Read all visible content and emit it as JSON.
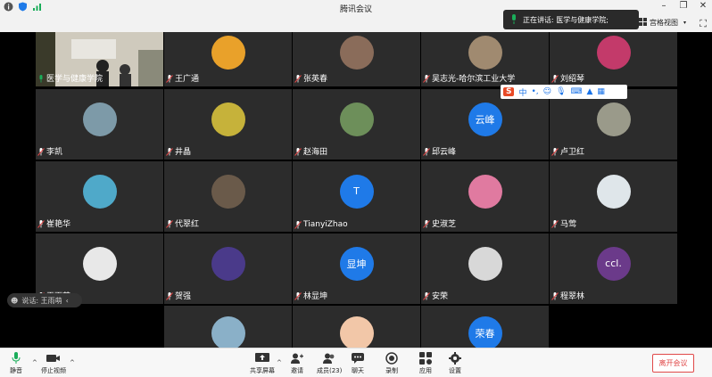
{
  "window": {
    "title": "腾讯会议"
  },
  "speaking_banner": {
    "label": "正在讲话: 医学与健康学院;"
  },
  "view": {
    "grid_label": "宫格视图"
  },
  "participants": [
    {
      "name": "医学与健康学院",
      "type": "video"
    },
    {
      "name": "王广通",
      "avatar": "garfield",
      "color": "#e9a12a"
    },
    {
      "name": "张英春",
      "avatar": "photo",
      "color": "#8a6c5a"
    },
    {
      "name": "吴志光-哈尔滨工业大学",
      "avatar": "photo",
      "color": "#a08a70"
    },
    {
      "name": "刘绍琴",
      "avatar": "flower",
      "color": "#c33a6a"
    },
    {
      "name": "李凯",
      "avatar": "photo",
      "color": "#7d9aa8"
    },
    {
      "name": "井晶",
      "avatar": "fruit",
      "color": "#c6b23a"
    },
    {
      "name": "赵海田",
      "avatar": "photo",
      "color": "#6d8f5a"
    },
    {
      "name": "邱云峰",
      "avatar": "text",
      "text": "云峰",
      "color": "#1f7ae8"
    },
    {
      "name": "卢卫红",
      "avatar": "photo",
      "color": "#9a9a8a"
    },
    {
      "name": "崔艳华",
      "avatar": "beach",
      "color": "#4fa9c9"
    },
    {
      "name": "代翠红",
      "avatar": "cat",
      "color": "#6a5a4a"
    },
    {
      "name": "TianyiZhao",
      "avatar": "text",
      "text": "T",
      "color": "#1f7ae8"
    },
    {
      "name": "史淑芝",
      "avatar": "flower",
      "color": "#e07aa0"
    },
    {
      "name": "马莺",
      "avatar": "baby",
      "color": "#dfe6ea"
    },
    {
      "name": "王雨萌",
      "avatar": "person",
      "color": "#e8e8e8"
    },
    {
      "name": "贺强",
      "avatar": "spiderman",
      "color": "#4a3a8a"
    },
    {
      "name": "林显坤",
      "avatar": "text",
      "text": "显坤",
      "color": "#1f7ae8"
    },
    {
      "name": "安荣",
      "avatar": "sketch",
      "color": "#d8d8d8"
    },
    {
      "name": "程翠林",
      "avatar": "text",
      "text": "ccl.",
      "color": "#6b3a8a"
    },
    {
      "name": "",
      "avatar": "sea",
      "color": "#8ab0c8"
    },
    {
      "name": "",
      "avatar": "cartoon",
      "color": "#f2c7a8"
    },
    {
      "name": "",
      "avatar": "text",
      "text": "荣春",
      "color": "#1f7ae8"
    }
  ],
  "mini_status": {
    "label": "说话: 王雨萌"
  },
  "ime": {
    "label": "中"
  },
  "bottom": {
    "mute": "静音",
    "stop_video": "停止视频",
    "share": "共享屏幕",
    "invite": "邀请",
    "members": "成员(23)",
    "chat": "聊天",
    "record": "录制",
    "apps": "应用",
    "settings": "设置",
    "leave": "离开会议"
  },
  "colors": {
    "accent_blue": "#1f7ae8",
    "leave_red": "#e04848",
    "mic_green": "#1aad5a"
  }
}
